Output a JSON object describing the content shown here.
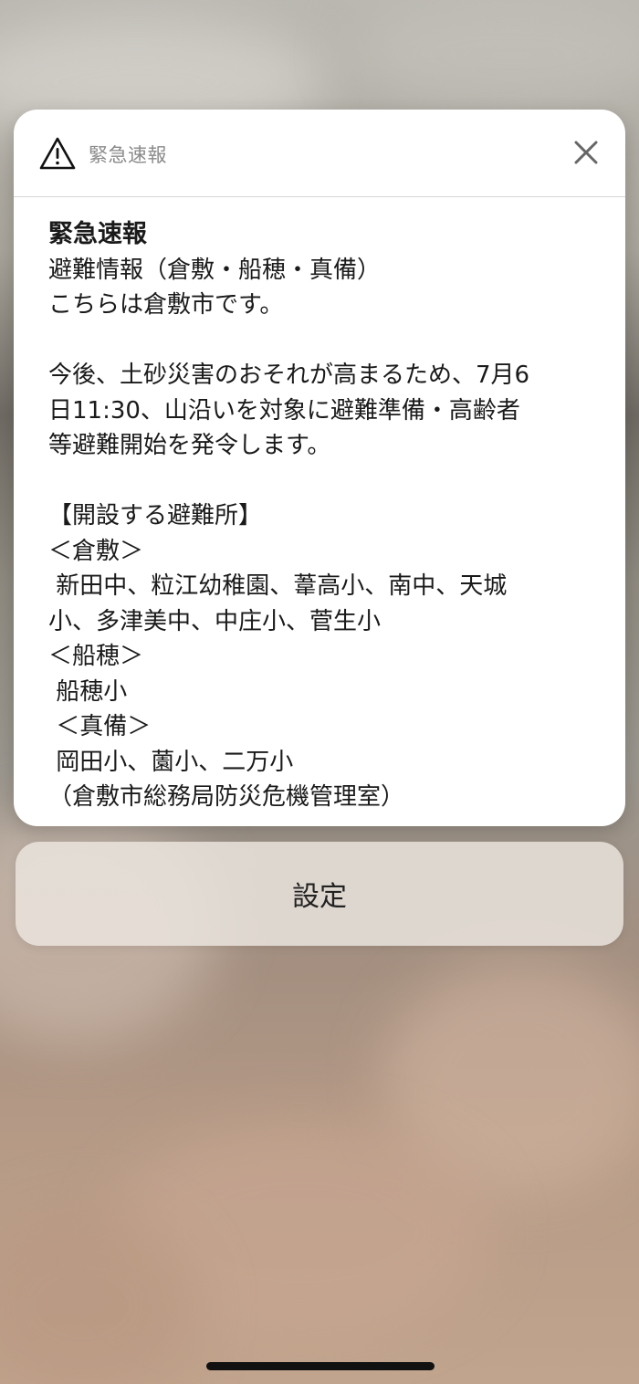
{
  "alert": {
    "header_title": "緊急速報",
    "header_icon": "warning-triangle-icon",
    "close_icon": "close-icon",
    "body_lines": [
      "緊急速報",
      "避難情報（倉敷・船穂・真備）",
      "こちらは倉敷市です。",
      "",
      "今後、土砂災害のおそれが高まるため、7月6",
      "日11:30、山沿いを対象に避難準備・高齢者",
      "等避難開始を発令します。",
      "",
      "【開設する避難所】",
      "＜倉敷＞",
      " 新田中、粒江幼稚園、葦高小、南中、天城",
      "小、多津美中、中庄小、菅生小",
      "＜船穂＞",
      " 船穂小",
      " ＜真備＞",
      " 岡田小、薗小、二万小",
      "（倉敷市総務局防災危機管理室）"
    ]
  },
  "settings_button": {
    "label": "設定"
  },
  "colors": {
    "card_background": "#ffffff",
    "header_text": "#8a8a8a",
    "body_text": "#1a1a1a"
  }
}
